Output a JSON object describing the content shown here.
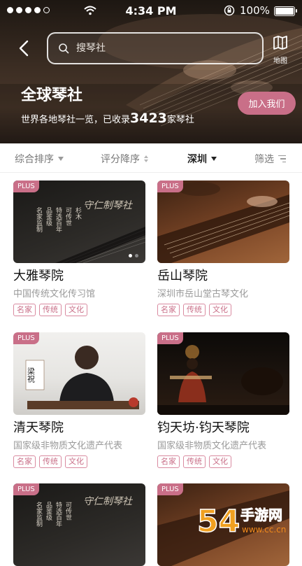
{
  "status_bar": {
    "time": "4:34 PM",
    "battery": "100%"
  },
  "header": {
    "search_placeholder": "搜琴社",
    "map_label": "地图",
    "title": "全球琴社",
    "join_button": "加入我们",
    "subtitle_prefix": "世界各地琴社一览，已收录",
    "count": "3423",
    "subtitle_suffix": "家琴社"
  },
  "filters": {
    "sort": "综合排序",
    "rating": "评分降序",
    "city": "深圳",
    "filter": "筛选"
  },
  "cards": [
    {
      "badge": "PLUS",
      "name": "大雅琴院",
      "desc": "中国传统文化传习馆",
      "tags": [
        "名家",
        "传统",
        "文化"
      ],
      "image_text": {
        "title": "守仁制琴社",
        "cols": [
          "名家监制",
          "品鉴级",
          "特选百年",
          "可传世",
          "杉木"
        ]
      }
    },
    {
      "badge": "PLUS",
      "name": "岳山琴院",
      "desc": "深圳市岳山堂古琴文化",
      "tags": [
        "名家",
        "传统",
        "文化"
      ]
    },
    {
      "badge": "PLUS",
      "name": "清天琴院",
      "desc": "国家级非物质文化遗产代表",
      "tags": [
        "名家",
        "传统",
        "文化"
      ],
      "image_text": {
        "banner": "梁祝"
      }
    },
    {
      "badge": "PLUS",
      "name": "钧天坊·钧天琴院",
      "desc": "国家级非物质文化遗产代表",
      "tags": [
        "名家",
        "传统",
        "文化"
      ]
    },
    {
      "badge": "PLUS",
      "image_text": {
        "title": "守仁制琴社",
        "cols": [
          "名家监制",
          "品鉴级",
          "特选百年",
          "可传世"
        ]
      }
    },
    {
      "badge": "PLUS"
    }
  ],
  "watermark": {
    "number": "54",
    "site": "手游网",
    "domain": "www.cc.cn"
  },
  "colors": {
    "accent": "#c96f88",
    "hero_bg": "#2e241d"
  }
}
